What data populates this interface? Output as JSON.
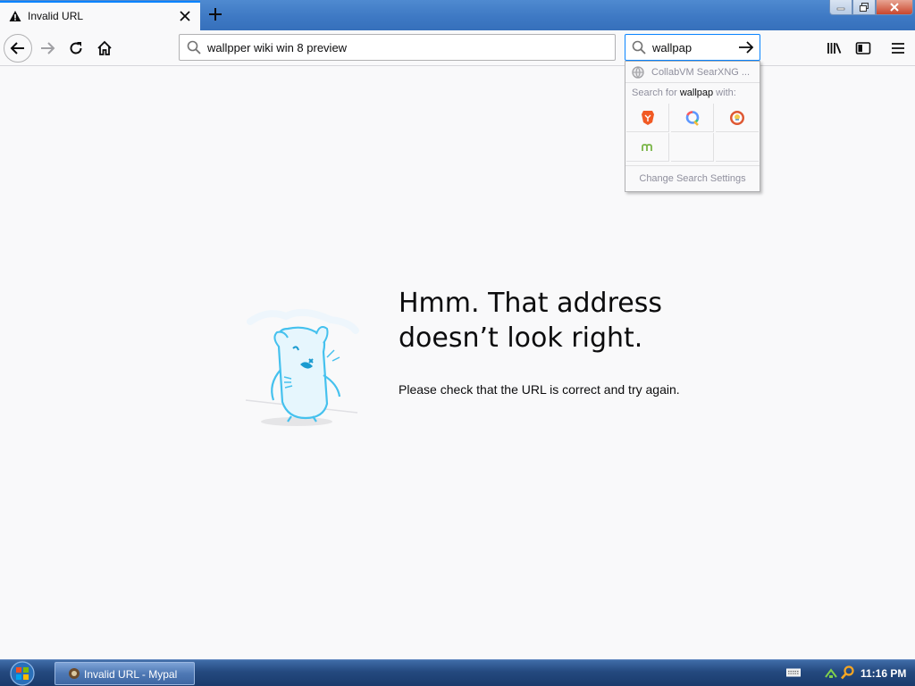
{
  "tab": {
    "title": "Invalid URL",
    "close_label": "×"
  },
  "navbar": {
    "url_value": "wallpper wiki win 8 preview",
    "search_value": "wallpap"
  },
  "search_popup": {
    "suggestion": "CollabVM SearXNG ...",
    "header_prefix": "Search for ",
    "header_term": "wallpap",
    "header_suffix": " with:",
    "engines": [
      "brave-icon",
      "qwant-icon",
      "duckduckgo-icon",
      "mojeek-icon"
    ],
    "settings_label": "Change Search Settings"
  },
  "error": {
    "title": "Hmm. That address doesn’t look right.",
    "description": "Please check that the URL is correct and try again."
  },
  "taskbar": {
    "task_label": "Invalid URL - Mypal",
    "clock": "11:16 PM"
  },
  "colors": {
    "accent": "#0a84ff",
    "page_bg": "#f9f9fa",
    "taskbar": "#24497f"
  }
}
